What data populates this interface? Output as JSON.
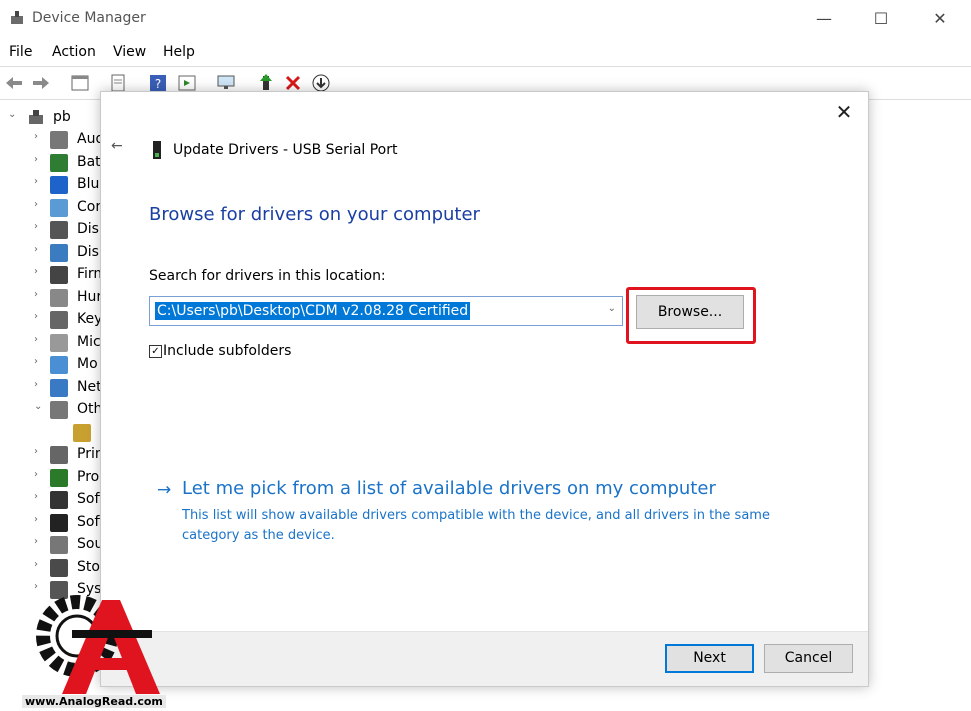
{
  "window": {
    "title": "Device Manager",
    "controls": {
      "minimize": "—",
      "maximize": "☐",
      "close": "✕"
    }
  },
  "menubar": {
    "items": [
      "File",
      "Action",
      "View",
      "Help"
    ]
  },
  "tree": {
    "root": "pb",
    "items": [
      "Aud",
      "Batt",
      "Blue",
      "Cor",
      "Disk",
      "Disp",
      "Firm",
      "Hur",
      "Key",
      "Mic",
      "Mo",
      "Net",
      "Oth",
      "",
      "Prin",
      "Pro",
      "Soft",
      "Soft",
      "Sou",
      "Stor",
      "Syst"
    ]
  },
  "dialog": {
    "close": "✕",
    "back": "←",
    "title": "Update Drivers - USB Serial Port",
    "heading": "Browse for drivers on your computer",
    "search_label": "Search for drivers in this location:",
    "path_value": "C:\\Users\\pb\\Desktop\\CDM v2.08.28 Certified",
    "browse_label": "Browse...",
    "include_subfolders": "Include subfolders",
    "include_checked": true,
    "pick_arrow": "→",
    "pick_link": "Let me pick from a list of available drivers on my computer",
    "pick_description": "This list will show available drivers compatible with the device, and all drivers in the same category as the device.",
    "next_label": "Next",
    "cancel_label": "Cancel"
  },
  "colors": {
    "accent": "#0078d7",
    "heading": "#1a3fa3",
    "link": "#1a73c8",
    "highlight": "#e0141e"
  },
  "watermark": {
    "text": "www.AnalogRead.com"
  }
}
